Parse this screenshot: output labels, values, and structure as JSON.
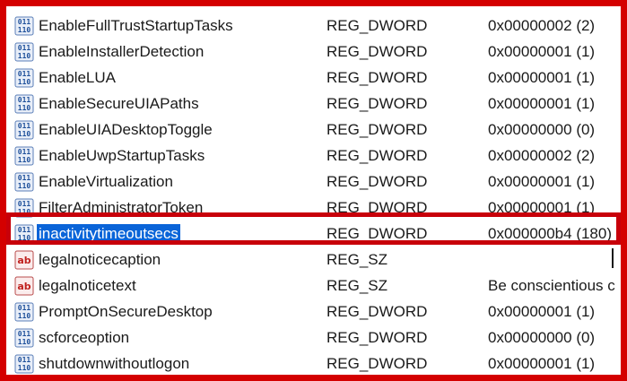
{
  "colors": {
    "frame_border": "#d40000",
    "highlight_border": "#c8000a",
    "selection_bg": "#0a64d8"
  },
  "rows": [
    {
      "name": "EnableFullTrustStartupTasks",
      "type": "REG_DWORD",
      "data": "0x00000002 (2)",
      "icon": "reg-dword-icon"
    },
    {
      "name": "EnableInstallerDetection",
      "type": "REG_DWORD",
      "data": "0x00000001 (1)",
      "icon": "reg-dword-icon"
    },
    {
      "name": "EnableLUA",
      "type": "REG_DWORD",
      "data": "0x00000001 (1)",
      "icon": "reg-dword-icon"
    },
    {
      "name": "EnableSecureUIAPaths",
      "type": "REG_DWORD",
      "data": "0x00000001 (1)",
      "icon": "reg-dword-icon"
    },
    {
      "name": "EnableUIADesktopToggle",
      "type": "REG_DWORD",
      "data": "0x00000000 (0)",
      "icon": "reg-dword-icon"
    },
    {
      "name": "EnableUwpStartupTasks",
      "type": "REG_DWORD",
      "data": "0x00000002 (2)",
      "icon": "reg-dword-icon"
    },
    {
      "name": "EnableVirtualization",
      "type": "REG_DWORD",
      "data": "0x00000001 (1)",
      "icon": "reg-dword-icon"
    },
    {
      "name": "FilterAdministratorToken",
      "type": "REG_DWORD",
      "data": "0x00000001 (1)",
      "icon": "reg-dword-icon"
    },
    {
      "name": "inactivitytimeoutsecs",
      "type": "REG_DWORD",
      "data": "0x000000b4 (180)",
      "icon": "reg-dword-icon",
      "selected": true
    },
    {
      "name": "legalnoticecaption",
      "type": "REG_SZ",
      "data": "",
      "icon": "reg-sz-icon"
    },
    {
      "name": "legalnoticetext",
      "type": "REG_SZ",
      "data": "Be conscientious c",
      "icon": "reg-sz-icon"
    },
    {
      "name": "PromptOnSecureDesktop",
      "type": "REG_DWORD",
      "data": "0x00000001 (1)",
      "icon": "reg-dword-icon"
    },
    {
      "name": "scforceoption",
      "type": "REG_DWORD",
      "data": "0x00000000 (0)",
      "icon": "reg-dword-icon"
    },
    {
      "name": "shutdownwithoutlogon",
      "type": "REG_DWORD",
      "data": "0x00000001 (1)",
      "icon": "reg-dword-icon"
    }
  ]
}
